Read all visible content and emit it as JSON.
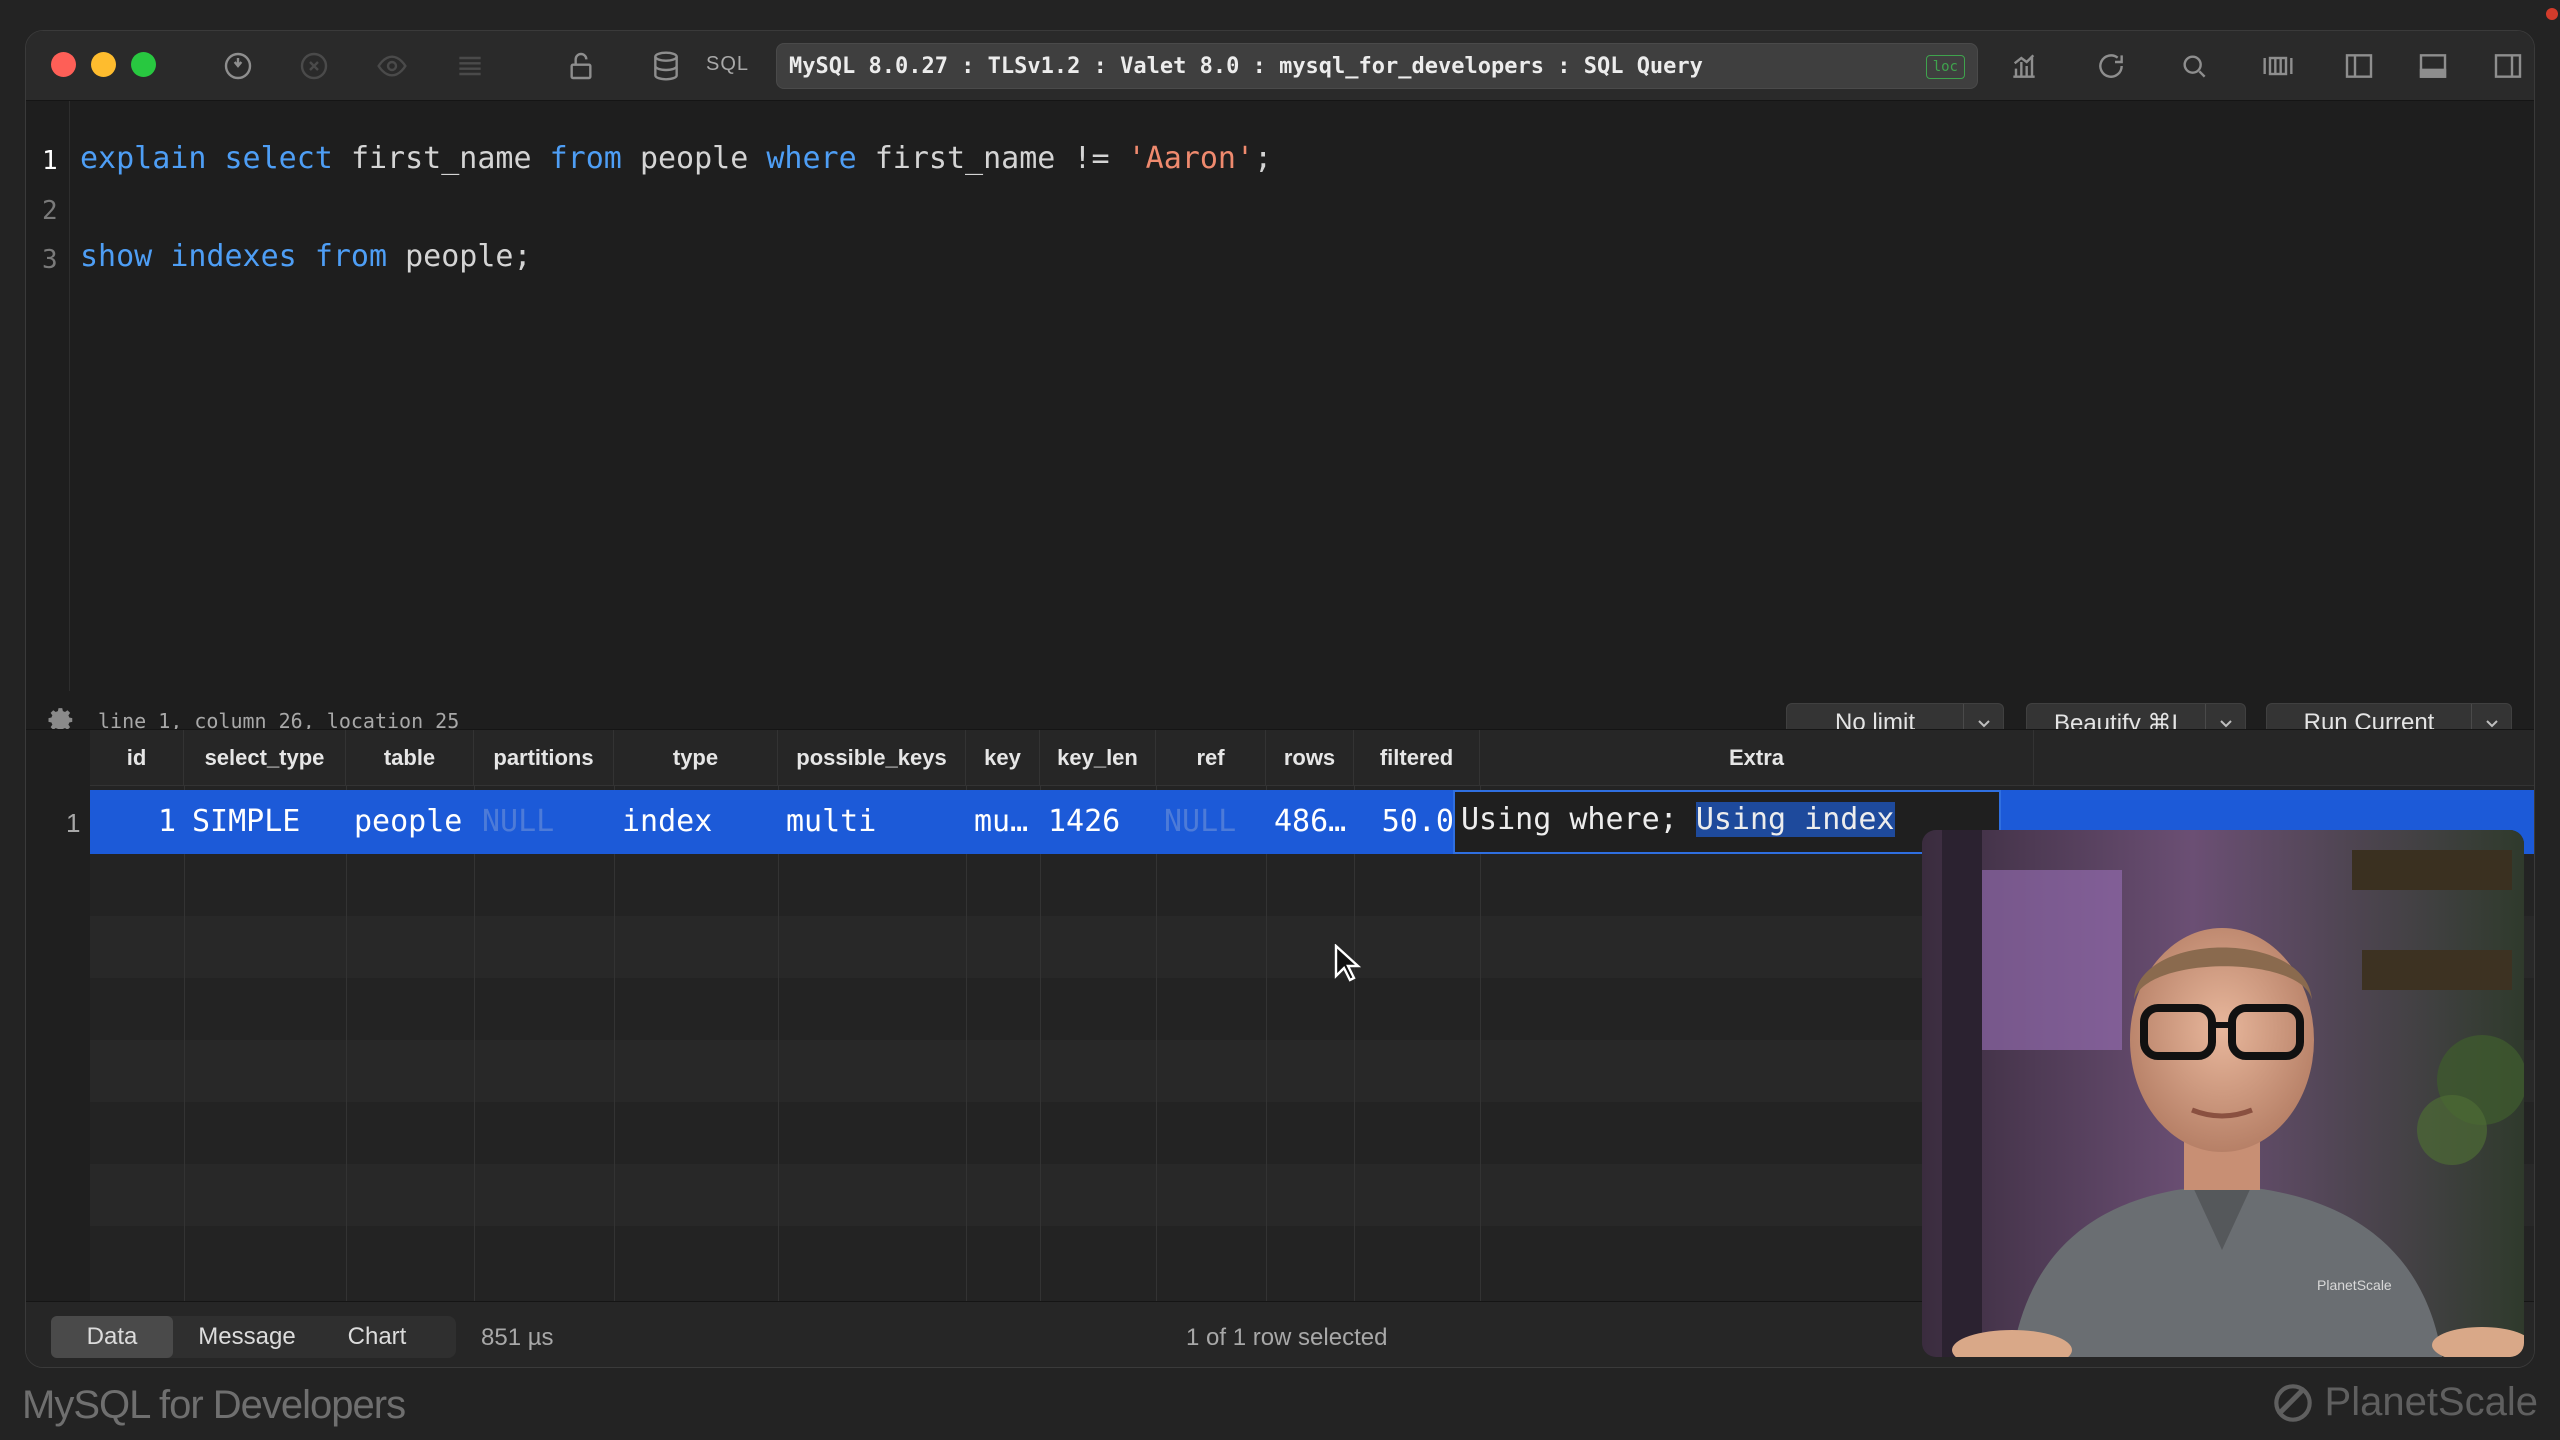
{
  "toolbar": {
    "sql_label": "SQL",
    "connection": "MySQL 8.0.27 : TLSv1.2 : Valet 8.0 : mysql_for_developers : SQL Query",
    "connection_badge": "loc"
  },
  "editor": {
    "line_numbers": [
      "1",
      "2",
      "3"
    ],
    "line1": {
      "kw1": "explain",
      "kw2": "select",
      "t1": "first_name",
      "kw3": "from",
      "t2": "people",
      "kw4": "where",
      "t3": "first_name !=",
      "str": "'Aaron'",
      "end": ";"
    },
    "line3": {
      "kw1": "show",
      "kw2": "indexes",
      "kw3": "from",
      "t1": "people;"
    },
    "status": "line 1, column 26, location 25"
  },
  "controls": {
    "limit": "No limit",
    "beautify": "Beautify ⌘I",
    "run": "Run Current"
  },
  "results": {
    "columns": [
      "id",
      "select_type",
      "table",
      "partitions",
      "type",
      "possible_keys",
      "key",
      "key_len",
      "ref",
      "rows",
      "filtered",
      "Extra"
    ],
    "row_number": "1",
    "row": {
      "id": "1",
      "select_type": "SIMPLE",
      "table": "people",
      "partitions": "NULL",
      "type": "index",
      "possible_keys": "multi",
      "key": "mu…",
      "key_len": "1426",
      "ref": "NULL",
      "rows": "486…",
      "filtered": "50.04",
      "extra_a": "Using where; ",
      "extra_b": "Using index"
    }
  },
  "bottom": {
    "tabs": [
      "Data",
      "Message",
      "Chart"
    ],
    "timing": "851 µs",
    "selection": "1 of 1 row selected"
  },
  "footer": {
    "course": "MySQL for Developers",
    "brand": "PlanetScale",
    "shirt_logo": "PlanetScale"
  },
  "colors": {
    "selection": "#1c5ad8",
    "keyword": "#4e9ef5",
    "string": "#ef8a6e"
  }
}
